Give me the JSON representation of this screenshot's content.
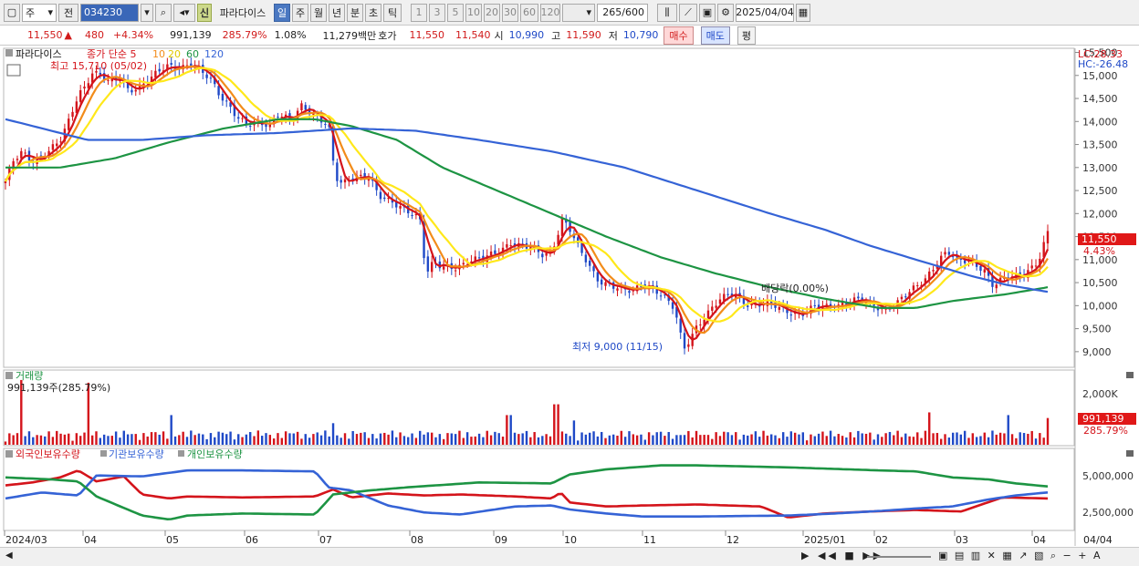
{
  "toolbar": {
    "period_type": "주",
    "period_prev": "전",
    "code": "034230",
    "new_tag": "신",
    "name": "파라다이스",
    "tabs": [
      "일",
      "주",
      "월",
      "년",
      "분",
      "초",
      "틱"
    ],
    "active_tab": "일",
    "intervals": [
      "1",
      "3",
      "5",
      "10",
      "20",
      "30",
      "60",
      "120"
    ],
    "count": "265",
    "count_total": "/600",
    "date": "2025/04/04"
  },
  "quote": {
    "price": "11,550",
    "change": "480",
    "change_pct": "+4.34%",
    "volume": "991,139",
    "vol_ratio": "285.79%",
    "turnover_pct": "1.08%",
    "amount": "11,279백만",
    "ask_label": "호가",
    "ask": "11,550",
    "bid": "11,540",
    "open_label": "시",
    "open": "10,990",
    "high_label": "고",
    "high": "11,590",
    "low_label": "저",
    "low": "10,790",
    "buy_label": "매수",
    "sell_label": "매도",
    "avg_label": "평"
  },
  "price_panel": {
    "title": "파라다이스",
    "legend_prefix": "종가 단순 5",
    "ma_labels": [
      "10",
      "20",
      "60",
      "120"
    ],
    "ma_colors": [
      "#d4141b",
      "#f28c1a",
      "#ffe81a",
      "#1d9443",
      "#3563d6"
    ],
    "high_note": "최고 15,710 (05/02)",
    "low_note": "최저 9,000 (11/15)",
    "dividend_note": "배당락(0.00%)",
    "lc_label": "LC:28.33",
    "hc_label": "HC:-26.48",
    "last_price": "11,550",
    "last_pct": "4.43%"
  },
  "volume_panel": {
    "title": "거래량",
    "value_note": "991,139주(285.79%)",
    "axis_label": "2,000K",
    "last_value": "991,139",
    "last_pct": "285.79%"
  },
  "holdings_panel": {
    "labels": [
      "외국인보유수량",
      "기관보유수량",
      "개인보유수량"
    ],
    "colors": [
      "#d4141b",
      "#3563d6",
      "#1d9443"
    ],
    "axis": [
      "5,000,000",
      "2,500,000"
    ]
  },
  "x_axis": [
    "2024/03",
    "04",
    "05",
    "06",
    "07",
    "08",
    "09",
    "10",
    "11",
    "12",
    "2025/01",
    "02",
    "03",
    "04",
    "04/04"
  ],
  "chart_data": {
    "type": "candlestick",
    "y_ticks": [
      9000,
      9500,
      10000,
      10500,
      11000,
      11500,
      12000,
      12500,
      13000,
      13500,
      14000,
      14500,
      15000,
      15500
    ],
    "ylim": [
      8700,
      15550
    ],
    "price_path": [
      [
        0,
        12700
      ],
      [
        8,
        13100
      ],
      [
        18,
        13300
      ],
      [
        30,
        13150
      ],
      [
        45,
        13350
      ],
      [
        60,
        13550
      ],
      [
        70,
        14000
      ],
      [
        80,
        14600
      ],
      [
        88,
        14800
      ],
      [
        95,
        15100
      ],
      [
        105,
        15000
      ],
      [
        115,
        14800
      ],
      [
        125,
        14950
      ],
      [
        135,
        14700
      ],
      [
        150,
        14800
      ],
      [
        165,
        15000
      ],
      [
        178,
        15200
      ],
      [
        190,
        15200
      ],
      [
        205,
        15250
      ],
      [
        215,
        15050
      ],
      [
        225,
        14900
      ],
      [
        235,
        14600
      ],
      [
        245,
        14400
      ],
      [
        255,
        14100
      ],
      [
        265,
        13900
      ],
      [
        275,
        13950
      ],
      [
        290,
        13950
      ],
      [
        300,
        14200
      ],
      [
        315,
        14000
      ],
      [
        325,
        14300
      ],
      [
        335,
        14200
      ],
      [
        345,
        14100
      ],
      [
        355,
        13950
      ],
      [
        362,
        12800
      ],
      [
        370,
        12600
      ],
      [
        385,
        12800
      ],
      [
        400,
        12850
      ],
      [
        410,
        12400
      ],
      [
        420,
        12250
      ],
      [
        430,
        12150
      ],
      [
        445,
        12050
      ],
      [
        455,
        11950
      ],
      [
        462,
        10700
      ],
      [
        470,
        10900
      ],
      [
        480,
        10800
      ],
      [
        495,
        10850
      ],
      [
        510,
        11000
      ],
      [
        525,
        11000
      ],
      [
        540,
        11150
      ],
      [
        555,
        11400
      ],
      [
        565,
        11300
      ],
      [
        575,
        11250
      ],
      [
        590,
        11100
      ],
      [
        600,
        11200
      ],
      [
        612,
        11900
      ],
      [
        620,
        11650
      ],
      [
        630,
        11200
      ],
      [
        640,
        10900
      ],
      [
        650,
        10600
      ],
      [
        660,
        10500
      ],
      [
        670,
        10400
      ],
      [
        680,
        10300
      ],
      [
        690,
        10300
      ],
      [
        700,
        10500
      ],
      [
        712,
        10400
      ],
      [
        722,
        10200
      ],
      [
        735,
        9900
      ],
      [
        745,
        9050
      ],
      [
        752,
        9300
      ],
      [
        760,
        9600
      ],
      [
        770,
        9800
      ],
      [
        785,
        10100
      ],
      [
        800,
        10300
      ],
      [
        815,
        10050
      ],
      [
        830,
        10000
      ],
      [
        845,
        10000
      ],
      [
        860,
        9900
      ],
      [
        875,
        9800
      ],
      [
        890,
        9950
      ],
      [
        905,
        10000
      ],
      [
        920,
        10050
      ],
      [
        935,
        10100
      ],
      [
        950,
        10050
      ],
      [
        965,
        9950
      ],
      [
        980,
        10050
      ],
      [
        995,
        10300
      ],
      [
        1010,
        10600
      ],
      [
        1025,
        11000
      ],
      [
        1035,
        11150
      ],
      [
        1045,
        10950
      ],
      [
        1060,
        11000
      ],
      [
        1075,
        10800
      ],
      [
        1085,
        10400
      ],
      [
        1100,
        10600
      ],
      [
        1115,
        10700
      ],
      [
        1125,
        10800
      ],
      [
        1135,
        10950
      ],
      [
        1145,
        11550
      ]
    ],
    "series": [
      {
        "name": "5",
        "color": "#d4141b",
        "smooth": 3
      },
      {
        "name": "10",
        "color": "#f28c1a",
        "smooth": 6
      },
      {
        "name": "20",
        "color": "#ffe81a",
        "smooth": 12
      },
      {
        "name": "60",
        "color": "#1d9443",
        "values_path": [
          [
            0,
            13000
          ],
          [
            60,
            13000
          ],
          [
            120,
            13200
          ],
          [
            180,
            13550
          ],
          [
            240,
            13850
          ],
          [
            300,
            14050
          ],
          [
            340,
            14050
          ],
          [
            380,
            13900
          ],
          [
            430,
            13600
          ],
          [
            480,
            13000
          ],
          [
            540,
            12500
          ],
          [
            600,
            12000
          ],
          [
            660,
            11500
          ],
          [
            720,
            11050
          ],
          [
            780,
            10700
          ],
          [
            840,
            10400
          ],
          [
            900,
            10150
          ],
          [
            960,
            9950
          ],
          [
            1000,
            9950
          ],
          [
            1040,
            10100
          ],
          [
            1100,
            10250
          ],
          [
            1145,
            10400
          ]
        ]
      },
      {
        "name": "120",
        "color": "#3563d6",
        "values_path": [
          [
            0,
            14050
          ],
          [
            40,
            13850
          ],
          [
            90,
            13600
          ],
          [
            150,
            13600
          ],
          [
            220,
            13700
          ],
          [
            300,
            13750
          ],
          [
            380,
            13850
          ],
          [
            450,
            13800
          ],
          [
            520,
            13600
          ],
          [
            600,
            13350
          ],
          [
            680,
            13000
          ],
          [
            760,
            12500
          ],
          [
            840,
            12000
          ],
          [
            900,
            11650
          ],
          [
            950,
            11300
          ],
          [
            1000,
            11000
          ],
          [
            1060,
            10650
          ],
          [
            1100,
            10450
          ],
          [
            1145,
            10300
          ]
        ]
      }
    ],
    "volume_max_k": 2600,
    "volume_spikes_k": [
      [
        17,
        2400
      ],
      [
        92,
        2300
      ],
      [
        183,
        1100
      ],
      [
        360,
        800
      ],
      [
        553,
        1100
      ],
      [
        605,
        1500
      ],
      [
        623,
        900
      ],
      [
        1015,
        1200
      ],
      [
        1100,
        1100
      ],
      [
        1145,
        991
      ]
    ],
    "holdings": [
      {
        "name": "외국인보유수량",
        "color": "#d4141b",
        "path": [
          [
            0,
            4400
          ],
          [
            30,
            4700
          ],
          [
            60,
            5200
          ],
          [
            80,
            5900
          ],
          [
            100,
            4800
          ],
          [
            130,
            5300
          ],
          [
            150,
            3500
          ],
          [
            180,
            3100
          ],
          [
            200,
            3300
          ],
          [
            260,
            3200
          ],
          [
            340,
            3300
          ],
          [
            360,
            4000
          ],
          [
            380,
            3200
          ],
          [
            420,
            3600
          ],
          [
            460,
            3400
          ],
          [
            500,
            3500
          ],
          [
            560,
            3300
          ],
          [
            600,
            3100
          ],
          [
            610,
            3700
          ],
          [
            620,
            2700
          ],
          [
            660,
            2300
          ],
          [
            700,
            2400
          ],
          [
            760,
            2500
          ],
          [
            830,
            2300
          ],
          [
            860,
            1200
          ],
          [
            900,
            1600
          ],
          [
            950,
            1800
          ],
          [
            1000,
            1950
          ],
          [
            1050,
            1800
          ],
          [
            1095,
            3200
          ],
          [
            1145,
            3100
          ]
        ]
      },
      {
        "name": "기관보유수량",
        "color": "#3563d6",
        "path": [
          [
            0,
            3100
          ],
          [
            40,
            3700
          ],
          [
            80,
            3400
          ],
          [
            100,
            5400
          ],
          [
            150,
            5300
          ],
          [
            200,
            5900
          ],
          [
            260,
            5900
          ],
          [
            340,
            5800
          ],
          [
            355,
            4200
          ],
          [
            380,
            3900
          ],
          [
            420,
            2400
          ],
          [
            460,
            1700
          ],
          [
            500,
            1500
          ],
          [
            560,
            2300
          ],
          [
            600,
            2400
          ],
          [
            620,
            2000
          ],
          [
            660,
            1600
          ],
          [
            700,
            1300
          ],
          [
            760,
            1300
          ],
          [
            860,
            1400
          ],
          [
            900,
            1550
          ],
          [
            960,
            1850
          ],
          [
            1000,
            2100
          ],
          [
            1040,
            2300
          ],
          [
            1080,
            3000
          ],
          [
            1110,
            3400
          ],
          [
            1145,
            3700
          ]
        ]
      },
      {
        "name": "개인보유수량",
        "color": "#1d9443",
        "path": [
          [
            0,
            5200
          ],
          [
            50,
            5000
          ],
          [
            80,
            4800
          ],
          [
            100,
            3300
          ],
          [
            150,
            1400
          ],
          [
            180,
            1000
          ],
          [
            200,
            1400
          ],
          [
            260,
            1600
          ],
          [
            340,
            1500
          ],
          [
            360,
            3500
          ],
          [
            400,
            3900
          ],
          [
            440,
            4200
          ],
          [
            520,
            4700
          ],
          [
            600,
            4600
          ],
          [
            620,
            5500
          ],
          [
            660,
            6000
          ],
          [
            720,
            6400
          ],
          [
            760,
            6400
          ],
          [
            860,
            6200
          ],
          [
            960,
            5900
          ],
          [
            1000,
            5800
          ],
          [
            1040,
            5200
          ],
          [
            1080,
            5000
          ],
          [
            1110,
            4600
          ],
          [
            1145,
            4300
          ]
        ]
      }
    ],
    "holdings_ylim": [
      0,
      7000
    ]
  }
}
